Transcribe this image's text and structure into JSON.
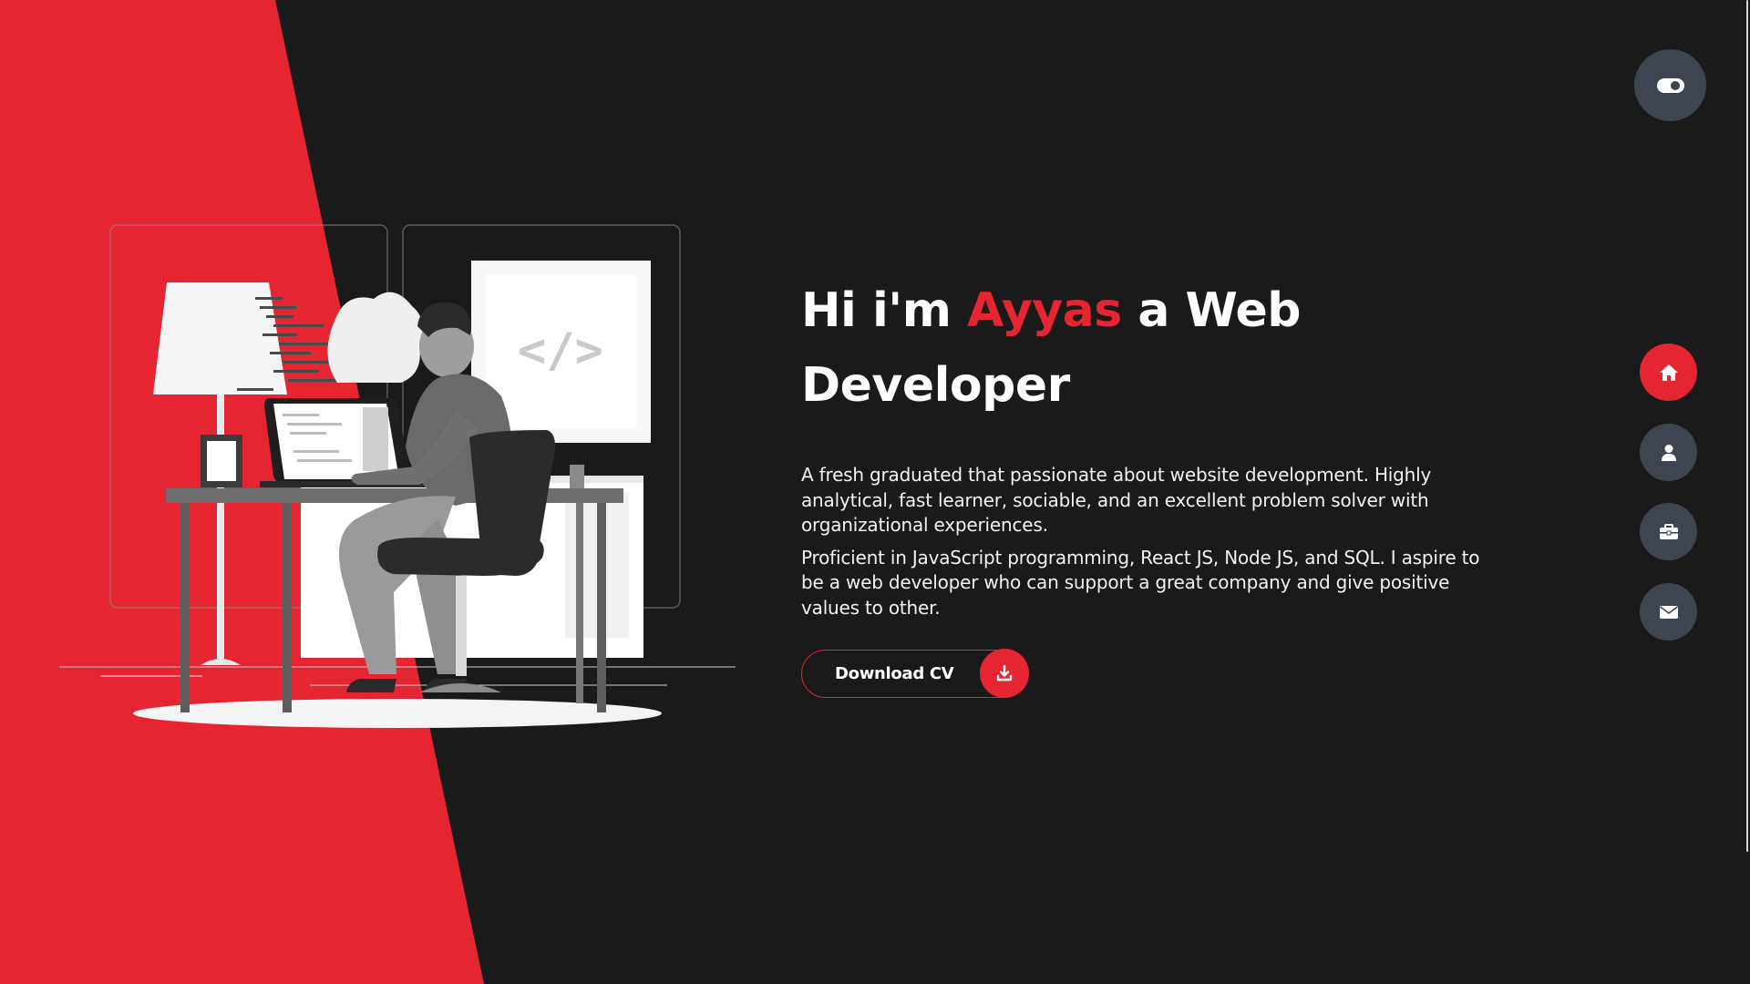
{
  "hero": {
    "title_prefix": "Hi i'm ",
    "title_name": "Ayyas",
    "title_suffix": " a Web Developer",
    "paragraph_1": "A fresh graduated that passionate about website development. Highly analytical, fast learner, sociable, and an excellent problem solver with organizational experiences.",
    "paragraph_2": "Proficient in JavaScript programming, React JS, Node JS, and SQL. I aspire to be a web developer who can support a great company and give positive values to other."
  },
  "download_button": {
    "label": "Download CV",
    "icon": "download-icon"
  },
  "illustration": {
    "code_symbol": "</>"
  },
  "theme_toggle": {
    "icon": "toggle-icon"
  },
  "nav": {
    "items": [
      {
        "id": "home",
        "icon": "home-icon",
        "active": true
      },
      {
        "id": "about",
        "icon": "user-icon",
        "active": false
      },
      {
        "id": "portfolio",
        "icon": "briefcase-icon",
        "active": false
      },
      {
        "id": "contact",
        "icon": "envelope-icon",
        "active": false
      }
    ]
  },
  "colors": {
    "accent": "#e52632",
    "background": "#191a19",
    "nav_button": "#3f4550",
    "text": "#ffffff"
  }
}
